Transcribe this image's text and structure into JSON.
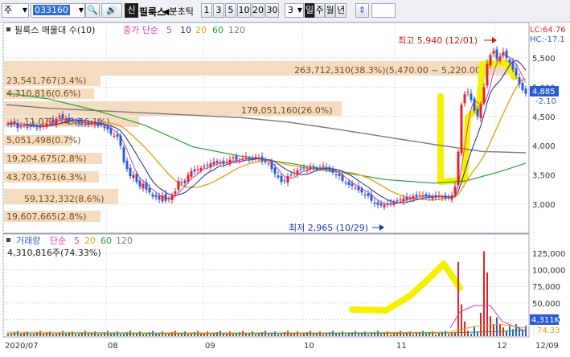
{
  "toolbar": {
    "market": "주",
    "code": "033160",
    "search_icon": "magnifier-icon",
    "sound_icon": "speaker-icon",
    "new_badge": "신",
    "stock_name": "필룩스",
    "period_prefix": "◀분초틱",
    "periods": [
      "1",
      "3",
      "5",
      "10",
      "20",
      "30"
    ],
    "count": "3",
    "day_selected": "일",
    "week": "주",
    "month": "월",
    "year": "년",
    "updown_icon": "up-down-arrow-icon"
  },
  "price_panel": {
    "legend_name": "필룩스 매물대 수(10)",
    "legend_ma": "종가 단순",
    "legend_ma_periods": [
      "5",
      "10",
      "20",
      "60",
      "120"
    ],
    "lc_label": "LC:64.76",
    "hc_label": "HC:-17.1",
    "max_label": "최고 5,940 (12/01)",
    "min_label": "최저 2,965 (10/29)",
    "current_price": "4,885",
    "change_pct": "-2.10",
    "y_ticks": [
      "5,500",
      "5,000",
      "4,500",
      "4,000",
      "3,500",
      "3,000"
    ],
    "volume_profile": [
      "263,712,310(38.3%)(5,470.00 ~ 5,220.00)",
      "23,541,767(3.4%)",
      "4,310,816(0.6%)",
      "179,051,160(26.0%)",
      "11,072,543(16.1%)",
      "5,051,498(0.7%)",
      "19,204,675(2.8%)",
      "43,703,761(6.3%)",
      "59,132,332(8.6%)",
      "19,607,665(2.8%)"
    ]
  },
  "volume_panel": {
    "legend_name": "거래량",
    "legend_ma": "단순",
    "legend_ma_periods": [
      "5",
      "20",
      "60",
      "120"
    ],
    "current_volume": "4,310,816주(74.33%)",
    "y_ticks": [
      "125,000",
      "100,000",
      "75,000",
      "50,000",
      "25,000"
    ],
    "current_badge": "4,311K",
    "pct_badge": "74.33"
  },
  "x_axis": [
    "2020/07",
    "08",
    "09",
    "10",
    "11",
    "12",
    "12/09"
  ],
  "colors": {
    "up": "#e8202a",
    "down": "#2a5bd7",
    "ma5": "#d63ea8",
    "ma10": "#1a2a8a",
    "ma20": "#e8a21a",
    "ma60": "#2a9d3a",
    "ma120": "#7a7a7a",
    "profile": "#f3dcc0",
    "highlight": "#f5f000"
  }
}
